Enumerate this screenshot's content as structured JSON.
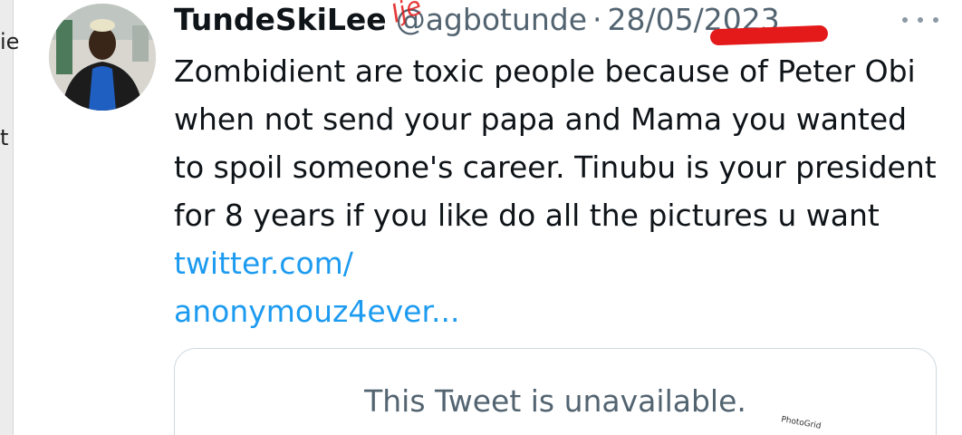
{
  "left_fragments": [
    "ie",
    "t"
  ],
  "tweet": {
    "display_name": "TundeSkiLee",
    "handle": "@agbotunde",
    "separator": "·",
    "date": "28/05/2023",
    "text_before_link": "Zombidient are toxic people because of Peter Obi when not send your papa and Mama you wanted to spoil someone's career. Tinubu is your president for 8 years if you like do all the pictures u want ",
    "link_line1": "twitter.com/",
    "link_line2": "anonymouz4ever...",
    "more_icon": "more-horizontal-icon"
  },
  "quote": {
    "text": "This Tweet is unavailable."
  },
  "watermark": {
    "text": "PhotoGrid"
  },
  "colors": {
    "text": "#0f1419",
    "secondary": "#536471",
    "link": "#1d9bf0",
    "card_border": "#cfd9de",
    "annotation_red": "#e3191a"
  }
}
